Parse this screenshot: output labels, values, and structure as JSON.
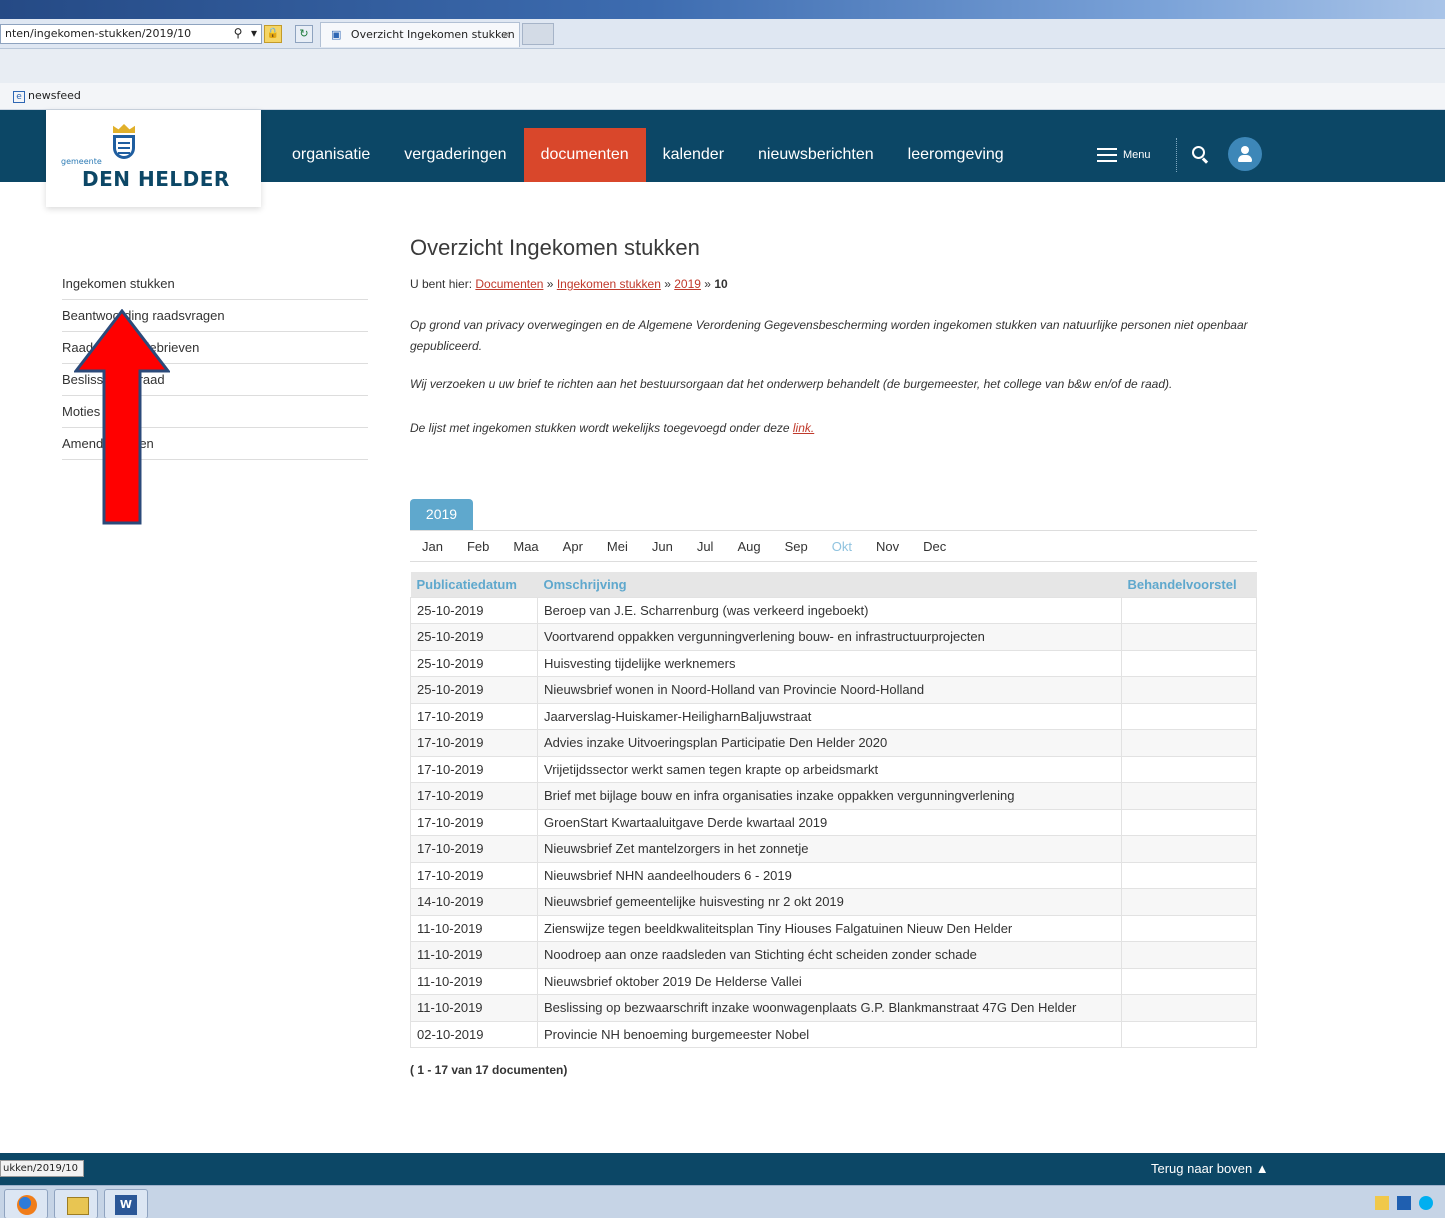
{
  "browser": {
    "address": "nten/ingekomen-stukken/2019/10",
    "tab_title": "Overzicht Ingekomen stukken",
    "tab_close": "×",
    "favorite": "newsfeed"
  },
  "site": {
    "logo_small": "gemeente",
    "logo_name": "DEN HELDER",
    "nav": [
      "organisatie",
      "vergaderingen",
      "documenten",
      "kalender",
      "nieuwsberichten",
      "leeromgeving"
    ],
    "nav_active": "documenten",
    "menu_label": "Menu"
  },
  "sidebar": {
    "items": [
      {
        "label": "Ingekomen stukken"
      },
      {
        "label": "Beantwoording raadsvragen"
      },
      {
        "label": "Raadsinformatiebrieven"
      },
      {
        "label": "Beslissingen raad"
      },
      {
        "label": "Moties"
      },
      {
        "label": "Amendementen"
      }
    ]
  },
  "main": {
    "title": "Overzicht Ingekomen stukken",
    "breadcrumb": {
      "prefix": "U bent hier:",
      "links": [
        "Documenten",
        "Ingekomen stukken",
        "2019"
      ],
      "sep": "»",
      "current": "10"
    },
    "intro1": "Op grond van privacy overwegingen en de Algemene Verordening Gegevensbescherming worden ingekomen stukken van natuurlijke personen niet openbaar gepubliceerd.",
    "intro2": "Wij verzoeken u uw brief te richten aan het bestuursorgaan dat het onderwerp behandelt (de burgemeester, het college van b&w en/of de raad).",
    "intro3_text": "De lijst met ingekomen stukken wordt wekelijks toegevoegd onder deze",
    "intro3_link": "link.",
    "year": "2019",
    "months": [
      "Jan",
      "Feb",
      "Maa",
      "Apr",
      "Mei",
      "Jun",
      "Jul",
      "Aug",
      "Sep",
      "Okt",
      "Nov",
      "Dec"
    ],
    "active_month": "Okt",
    "columns": [
      "Publicatiedatum",
      "Omschrijving",
      "Behandelvoorstel"
    ],
    "rows": [
      {
        "date": "25-10-2019",
        "title": "Beroep van J.E. Scharrenburg (was verkeerd ingeboekt)",
        "behandel": ""
      },
      {
        "date": "25-10-2019",
        "title": "Voortvarend oppakken vergunningverlening bouw- en infrastructuurprojecten",
        "behandel": ""
      },
      {
        "date": "25-10-2019",
        "title": "Huisvesting tijdelijke werknemers",
        "behandel": ""
      },
      {
        "date": "25-10-2019",
        "title": "Nieuwsbrief wonen in Noord-Holland van Provincie Noord-Holland",
        "behandel": ""
      },
      {
        "date": "17-10-2019",
        "title": "Jaarverslag-Huiskamer-HeiligharnBaljuwstraat",
        "behandel": ""
      },
      {
        "date": "17-10-2019",
        "title": "Advies inzake Uitvoeringsplan Participatie Den Helder 2020",
        "behandel": ""
      },
      {
        "date": "17-10-2019",
        "title": "Vrijetijdssector werkt samen tegen krapte op arbeidsmarkt",
        "behandel": ""
      },
      {
        "date": "17-10-2019",
        "title": "Brief met bijlage bouw en infra organisaties inzake oppakken vergunningverlening",
        "behandel": ""
      },
      {
        "date": "17-10-2019",
        "title": "GroenStart Kwartaaluitgave Derde kwartaal 2019",
        "behandel": ""
      },
      {
        "date": "17-10-2019",
        "title": "Nieuwsbrief Zet mantelzorgers in het zonnetje",
        "behandel": ""
      },
      {
        "date": "17-10-2019",
        "title": "Nieuwsbrief NHN aandeelhouders 6 - 2019",
        "behandel": ""
      },
      {
        "date": "14-10-2019",
        "title": "Nieuwsbrief gemeentelijke huisvesting nr 2 okt 2019",
        "behandel": ""
      },
      {
        "date": "11-10-2019",
        "title": "Zienswijze tegen beeldkwaliteitsplan Tiny Hiouses Falgatuinen Nieuw Den Helder",
        "behandel": ""
      },
      {
        "date": "11-10-2019",
        "title": "Noodroep aan onze raadsleden van Stichting écht scheiden zonder schade",
        "behandel": ""
      },
      {
        "date": "11-10-2019",
        "title": "Nieuwsbrief oktober 2019 De Helderse Vallei",
        "behandel": ""
      },
      {
        "date": "11-10-2019",
        "title": "Beslissing op bezwaarschrift inzake woonwagenplaats G.P. Blankmanstraat 47G Den Helder",
        "behandel": ""
      },
      {
        "date": "02-10-2019",
        "title": "Provincie NH benoeming burgemeester Nobel",
        "behandel": ""
      }
    ],
    "count": "( 1 - 17 van 17 documenten)"
  },
  "footer": {
    "back_to_top": "Terug naar boven ▲",
    "status_url": "ukken/2019/10"
  },
  "colors": {
    "header_bg": "#0c4766",
    "active_nav": "#d9472b",
    "accent_blue": "#5fa8cd",
    "link_red": "#c0392b",
    "annotation_arrow": "#ff0000"
  }
}
